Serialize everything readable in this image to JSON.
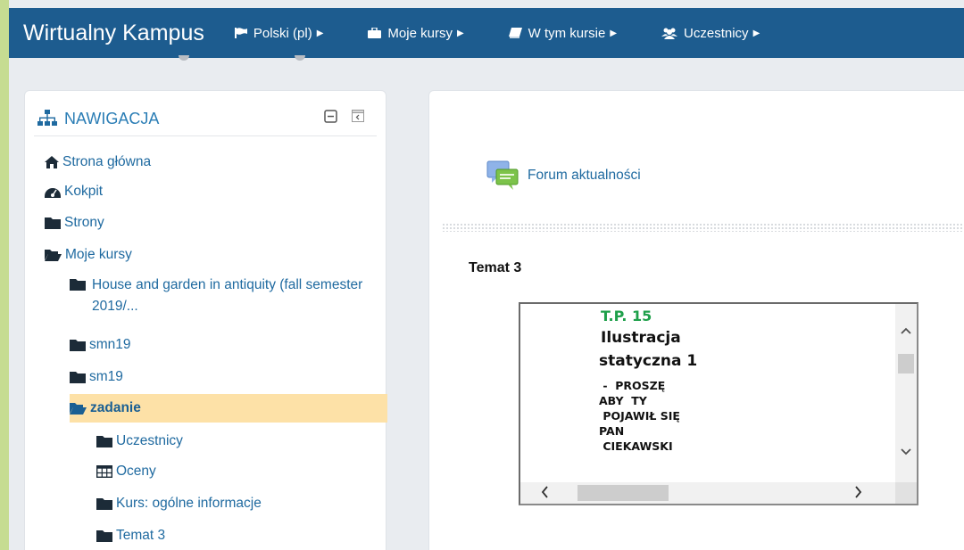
{
  "app": {
    "title": "Wirtualny Kampus"
  },
  "navbar": {
    "items": [
      {
        "label": "Polski (pl)",
        "icon": "flag-icon"
      },
      {
        "label": "Moje kursy",
        "icon": "briefcase-icon"
      },
      {
        "label": "W tym kursie",
        "icon": "book-icon"
      },
      {
        "label": "Uczestnicy",
        "icon": "users-icon"
      }
    ]
  },
  "navigation_block": {
    "title": "NAWIGACJA",
    "items": [
      {
        "label": "Strona główna",
        "icon": "home-icon"
      },
      {
        "label": "Kokpit",
        "icon": "dashboard-icon"
      },
      {
        "label": "Strony",
        "icon": "folder-icon"
      },
      {
        "label": "Moje kursy",
        "icon": "folder-open-icon"
      },
      {
        "label": "House and garden in antiquity (fall semester 2019/...",
        "icon": "folder-icon"
      },
      {
        "label": "smn19",
        "icon": "folder-icon"
      },
      {
        "label": "sm19",
        "icon": "folder-icon"
      },
      {
        "label": "zadanie",
        "icon": "folder-open-icon",
        "active": true
      },
      {
        "label": "Uczestnicy",
        "icon": "folder-icon"
      },
      {
        "label": "Oceny",
        "icon": "table-icon"
      },
      {
        "label": "Kurs: ogólne informacje",
        "icon": "folder-icon"
      },
      {
        "label": "Temat 3",
        "icon": "folder-icon"
      }
    ]
  },
  "main": {
    "forum_link": "Forum aktualności",
    "section_title": "Temat 3",
    "embedded": {
      "line1": "T.P.  15",
      "line2": "Ilustracja",
      "line3": "statyczna 1",
      "line4": " -  PROSZĘ",
      "line5": "ABY  TY",
      "line6": " POJAWIŁ SIĘ",
      "line7": "PAN",
      "line8": " CIEKAWSKI"
    }
  },
  "colors": {
    "navbar": "#1d5c8f",
    "link": "#1f6aa0",
    "active_bg": "#fde1a7",
    "outer_bg": "#c6dc92",
    "green_text": "#1ea04a"
  }
}
